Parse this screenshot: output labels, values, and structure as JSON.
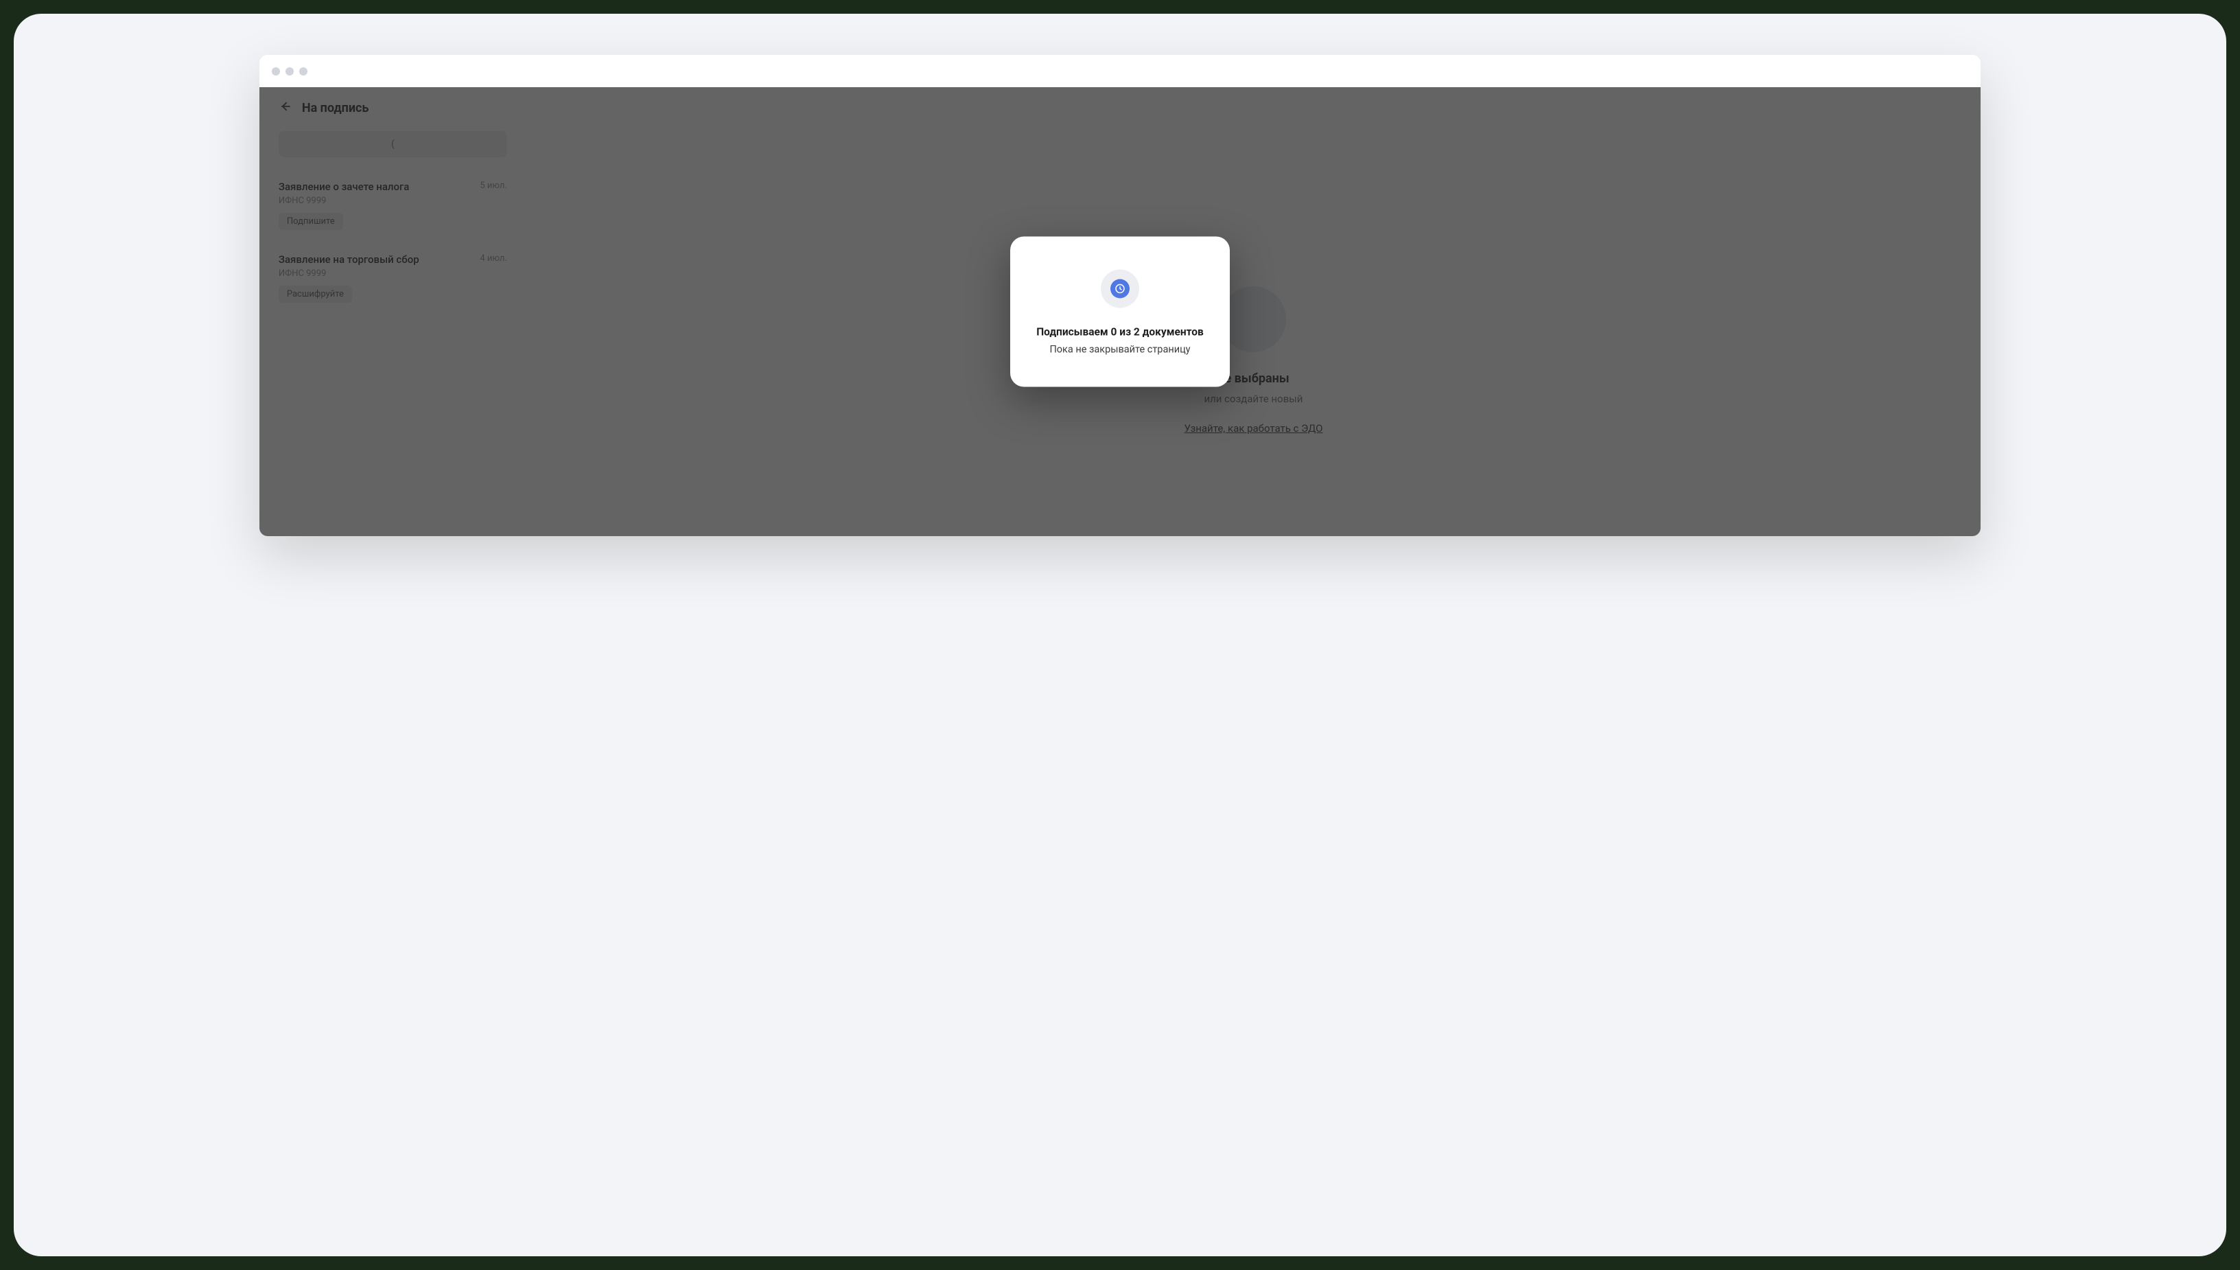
{
  "header": {
    "title": "На подпись"
  },
  "filter": {
    "text": "("
  },
  "docs": [
    {
      "title": "Заявление о зачете налога",
      "date": "5 июл.",
      "sub": "ИФНС 9999",
      "chip": "Подпишите"
    },
    {
      "title": "Заявление на торговый сбор",
      "date": "4 июл.",
      "sub": "ИФНС 9999",
      "chip": "Расшифруйте"
    }
  ],
  "empty": {
    "title": "не выбраны",
    "sub": "или создайте новый",
    "link": "Узнайте, как работать с ЭДО"
  },
  "modal": {
    "title": "Подписываем 0 из 2 документов",
    "sub": "Пока не закрывайте страницу"
  }
}
